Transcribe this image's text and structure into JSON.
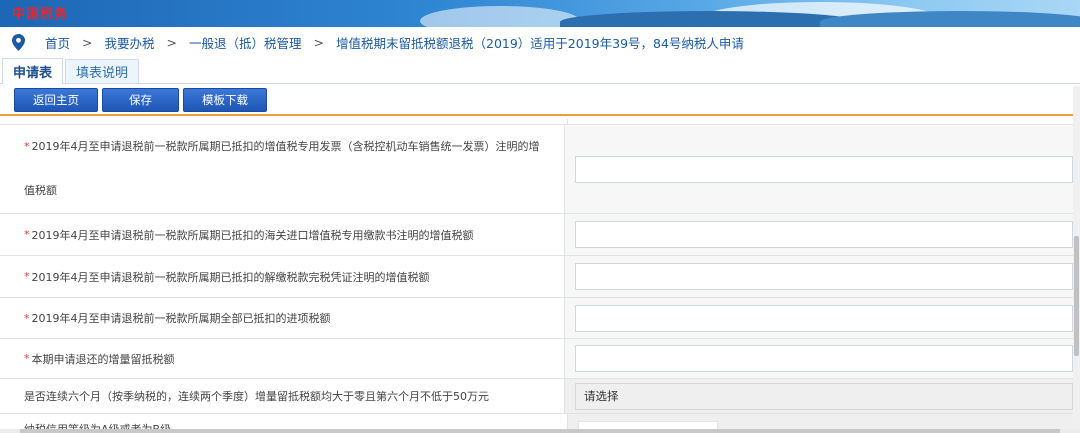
{
  "header": {
    "logo_text": "中国税务"
  },
  "breadcrumb": {
    "items": [
      "首页",
      "我要办税",
      "一般退（抵）税管理",
      "增值税期末留抵税额退税（2019）适用于2019年39号，84号纳税人申请"
    ],
    "separator": ">"
  },
  "tabs": [
    {
      "label": "申请表",
      "active": true
    },
    {
      "label": "填表说明",
      "active": false
    }
  ],
  "toolbar": {
    "back_label": "返回主页",
    "save_label": "保存",
    "template_label": "模板下载"
  },
  "form": {
    "required_mark": "*",
    "rows": [
      {
        "line1": "2019年4月至申请退税前一税款所属期已抵扣的增值税专用发票（含税控机动车销售统一发票）注明的增",
        "line2": "值税额"
      },
      {
        "label": "2019年4月至申请退税前一税款所属期已抵扣的海关进口增值税专用缴款书注明的增值税额"
      },
      {
        "label": "2019年4月至申请退税前一税款所属期已抵扣的解缴税款完税凭证注明的增值税额"
      },
      {
        "label": "2019年4月至申请退税前一税款所属期全部已抵扣的进项税额"
      },
      {
        "label": "本期申请退还的增量留抵税额"
      },
      {
        "label": "是否连续六个月（按季纳税的，连续两个季度）增量留抵税额均大于零且第六个月不低于50万元",
        "select_value": "请选择"
      },
      {
        "label": "纳税信用等级为A级或者为B级"
      }
    ]
  },
  "colors": {
    "accent": "#1f56b5",
    "toolbar_border": "#e9a23b",
    "required": "#e23b3b"
  }
}
